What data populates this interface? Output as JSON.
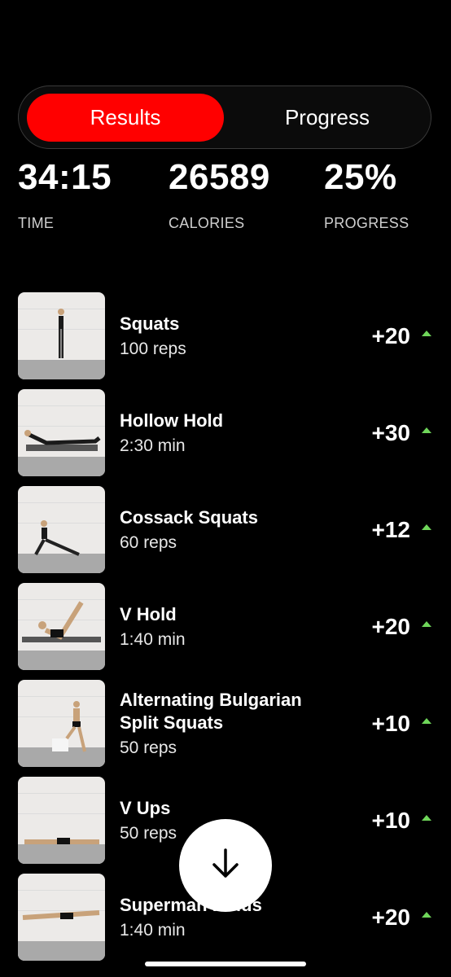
{
  "tabs": [
    {
      "label": "Results",
      "active": true
    },
    {
      "label": "Progress",
      "active": false
    }
  ],
  "stats": [
    {
      "value": "34:15",
      "label": "TIME"
    },
    {
      "value": "26589",
      "label": "CALORIES"
    },
    {
      "value": "25%",
      "label": "PROGRESS"
    }
  ],
  "exercises": [
    {
      "name": "Squats",
      "detail": "100 reps",
      "delta": "+20"
    },
    {
      "name": "Hollow Hold",
      "detail": "2:30 min",
      "delta": "+30"
    },
    {
      "name": "Cossack Squats",
      "detail": "60 reps",
      "delta": "+12"
    },
    {
      "name": "V Hold",
      "detail": "1:40 min",
      "delta": "+20"
    },
    {
      "name": "Alternating Bulgarian Split Squats",
      "detail": "50 reps",
      "delta": "+10"
    },
    {
      "name": "V Ups",
      "detail": "50 reps",
      "delta": "+10"
    },
    {
      "name": "Superman Holds",
      "detail": "1:40 min",
      "delta": "+20"
    }
  ],
  "colors": {
    "accent": "#ff0000",
    "up_arrow": "#6fd65a",
    "background": "#000000"
  },
  "fab": {
    "icon": "arrow-down-icon"
  }
}
